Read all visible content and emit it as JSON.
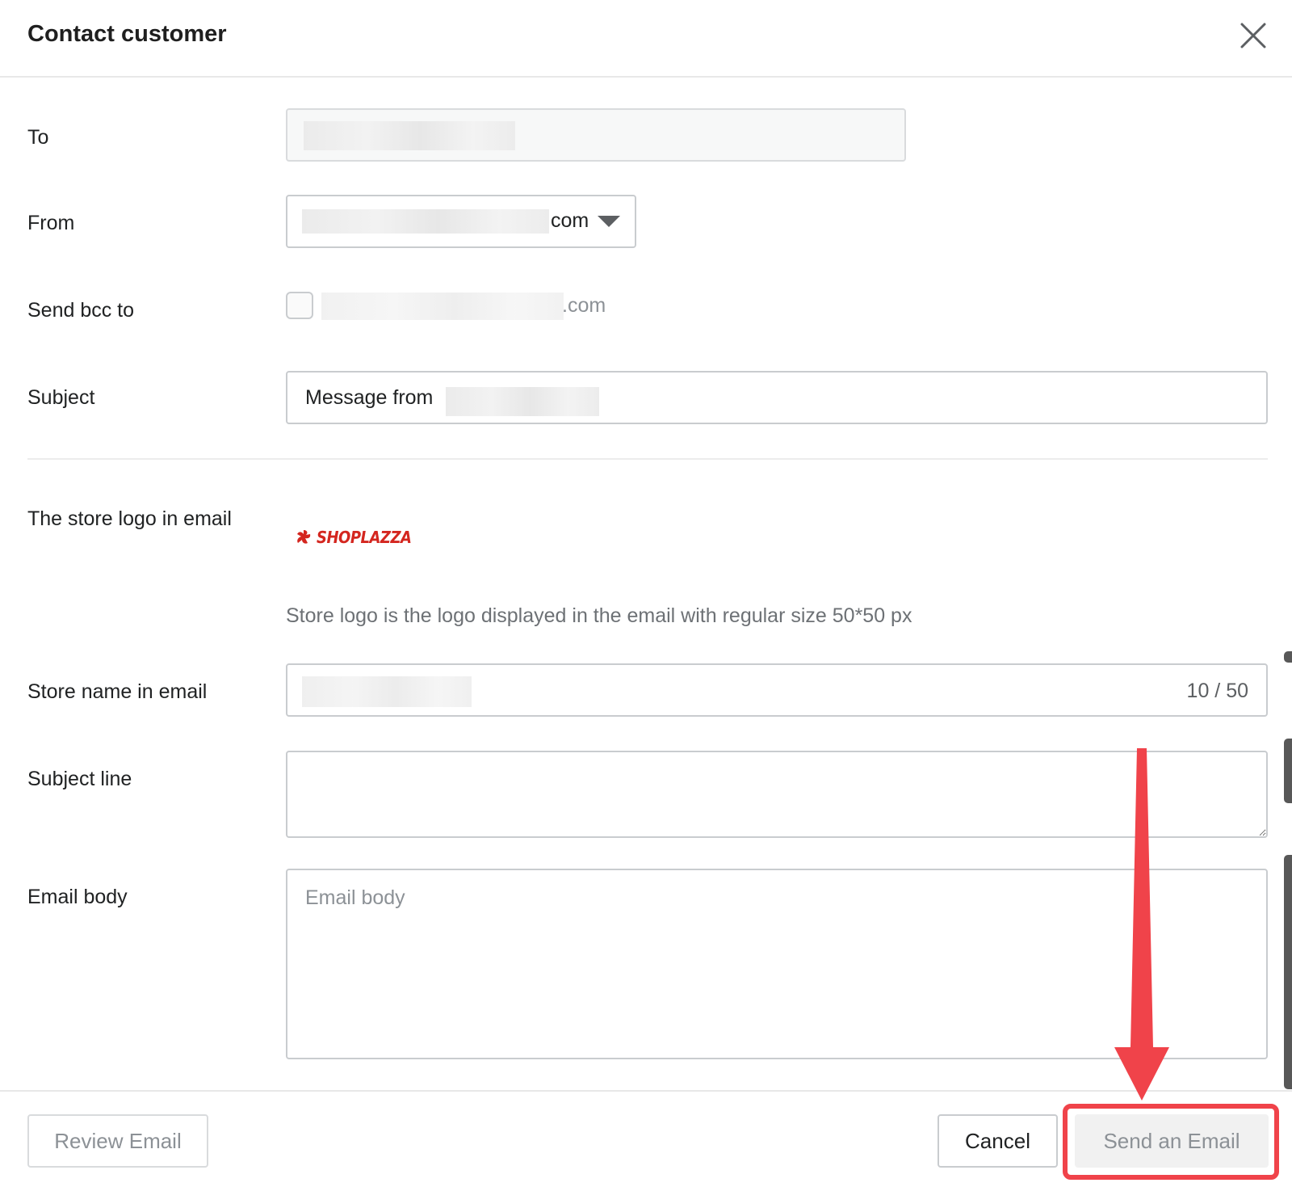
{
  "dialog": {
    "title": "Contact customer"
  },
  "form": {
    "to_label": "To",
    "from_label": "From",
    "from_value_suffix": "com",
    "bcc_label": "Send bcc to",
    "bcc_value_suffix": ".com",
    "subject_label": "Subject",
    "subject_value_prefix": "Message from",
    "logo_label": "The store logo in email",
    "logo_text": "SHOPLAZZA",
    "logo_help": "Store logo is the logo displayed in the email with regular size 50*50 px",
    "store_name_label": "Store name in email",
    "store_name_counter": "10 / 50",
    "subject_line_label": "Subject line",
    "email_body_label": "Email body",
    "email_body_placeholder": "Email body"
  },
  "footer": {
    "review_label": "Review Email",
    "cancel_label": "Cancel",
    "send_label": "Send an Email"
  },
  "colors": {
    "annotation": "#f0434a",
    "logo": "#d4261f"
  },
  "icons": {
    "close": "close-icon",
    "dropdown": "caret-down-icon",
    "logo": "shoplazza-logo-icon",
    "annotation_arrow": "arrow-down-icon"
  }
}
